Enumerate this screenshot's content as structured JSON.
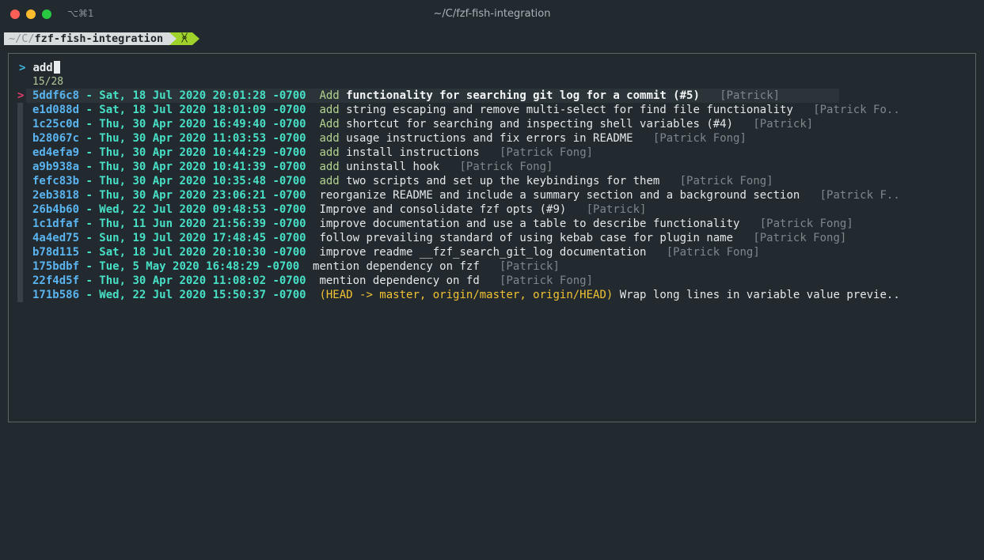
{
  "window": {
    "title": "~/C/fzf-fish-integration",
    "shortcut": "⌥⌘1"
  },
  "prompt": {
    "path_prefix": "~/C/",
    "path_dir": "fzf-fish-integration",
    "git_icon": "ᚸ"
  },
  "fzf": {
    "pointer": ">",
    "query": "add",
    "count": "15/28",
    "row_marker": ">",
    "rows": [
      {
        "hash": "5ddf6c8",
        "date": " - Sat, 18 Jul 2020 20:01:28 -0700  ",
        "match": "Add",
        "message": " functionality for searching git log for a commit (#5)   ",
        "author": "[Patrick]",
        "selected": true
      },
      {
        "hash": "e1d088d",
        "date": " - Sat, 18 Jul 2020 18:01:09 -0700  ",
        "match": "add",
        "message": " string escaping and remove multi-select for find file functionality   ",
        "author": "[Patrick Fo.."
      },
      {
        "hash": "1c25c0d",
        "date": " - Thu, 30 Apr 2020 16:49:40 -0700  ",
        "match": "Add",
        "message": " shortcut for searching and inspecting shell variables (#4)   ",
        "author": "[Patrick]"
      },
      {
        "hash": "b28067c",
        "date": " - Thu, 30 Apr 2020 11:03:53 -0700  ",
        "match": "add",
        "message": " usage instructions and fix errors in README   ",
        "author": "[Patrick Fong]"
      },
      {
        "hash": "ed4efa9",
        "date": " - Thu, 30 Apr 2020 10:44:29 -0700  ",
        "match": "add",
        "message": " install instructions   ",
        "author": "[Patrick Fong]"
      },
      {
        "hash": "a9b938a",
        "date": " - Thu, 30 Apr 2020 10:41:39 -0700  ",
        "match": "add",
        "message": " uninstall hook   ",
        "author": "[Patrick Fong]"
      },
      {
        "hash": "fefc83b",
        "date": " - Thu, 30 Apr 2020 10:35:48 -0700  ",
        "match": "add",
        "message": " two scripts and set up the keybindings for them   ",
        "author": "[Patrick Fong]"
      },
      {
        "hash": "2eb3818",
        "date": " - Thu, 30 Apr 2020 23:06:21 -0700  ",
        "message": "reorganize README and include a summary section and a background section   ",
        "author": "[Patrick F.."
      },
      {
        "hash": "26b4b60",
        "date": " - Wed, 22 Jul 2020 09:48:53 -0700  ",
        "message": "Improve and consolidate fzf opts (#9)   ",
        "author": "[Patrick]"
      },
      {
        "hash": "1c1dfaf",
        "date": " - Thu, 11 Jun 2020 21:56:39 -0700  ",
        "message": "improve documentation and use a table to describe functionality   ",
        "author": "[Patrick Fong]"
      },
      {
        "hash": "4a4ed75",
        "date": " - Sun, 19 Jul 2020 17:48:45 -0700  ",
        "message": "follow prevailing standard of using kebab case for plugin name   ",
        "author": "[Patrick Fong]"
      },
      {
        "hash": "b78d115",
        "date": " - Sat, 18 Jul 2020 20:10:30 -0700  ",
        "message": "improve readme __fzf_search_git_log documentation   ",
        "author": "[Patrick Fong]"
      },
      {
        "hash": "175bdbf",
        "date": " - Tue, 5 May 2020 16:48:29 -0700  ",
        "message": "mention dependency on fzf   ",
        "author": "[Patrick]"
      },
      {
        "hash": "22f4d5f",
        "date": " - Thu, 30 Apr 2020 11:08:02 -0700  ",
        "message": "mention dependency on fd   ",
        "author": "[Patrick Fong]"
      },
      {
        "hash": "171b586",
        "date": " - Wed, 22 Jul 2020 15:50:37 -0700  ",
        "refs": "(HEAD -> master, origin/master, origin/HEAD)",
        "message": " Wrap long lines in variable value previe.."
      }
    ]
  },
  "colors": {
    "background": "#222a2f",
    "hash": "#5ab4f0",
    "date": "#47e0c6",
    "match": "#b3d38e",
    "author": "#7e878c",
    "refs": "#f1c232",
    "marker": "#e23c6a",
    "git_segment": "#9fd22b"
  }
}
